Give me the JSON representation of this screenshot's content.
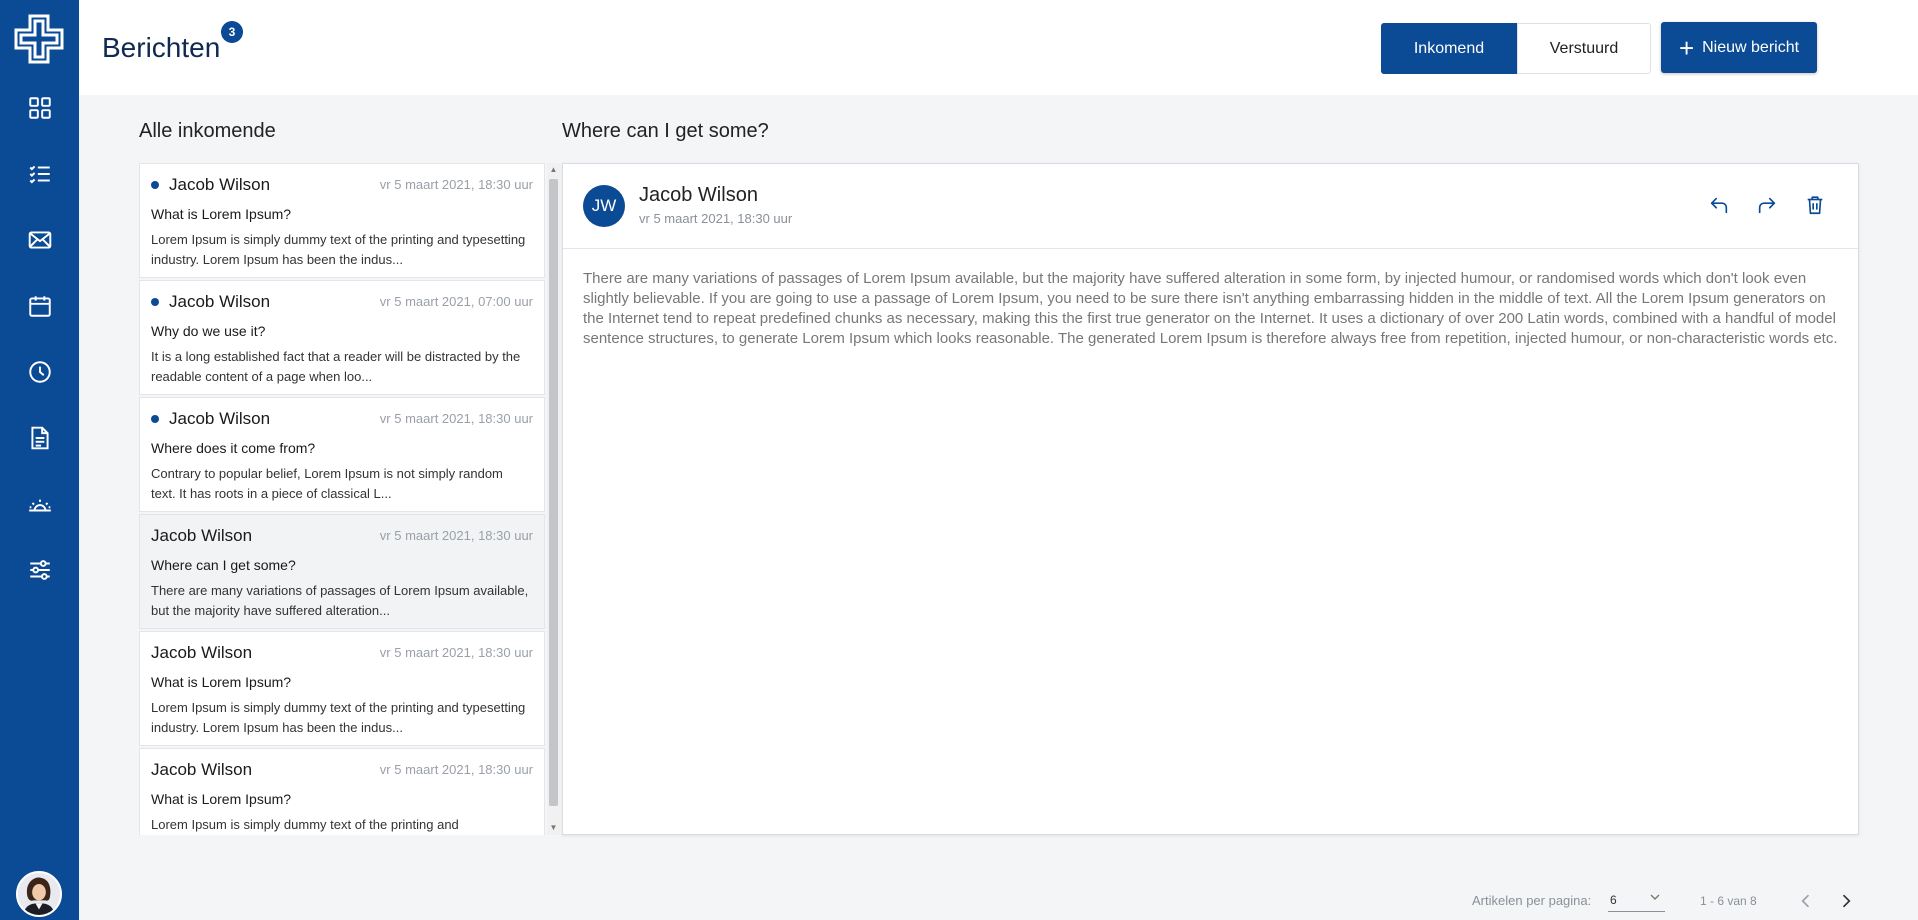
{
  "colors": {
    "primary": "#0b4a94",
    "background": "#f4f5f7",
    "unread_dot": "#0b4a94"
  },
  "sidebar": {
    "logo": "brand-cross-logo",
    "items": [
      {
        "icon": "dashboard-grid-icon"
      },
      {
        "icon": "checklist-icon"
      },
      {
        "icon": "mail-icon"
      },
      {
        "icon": "calendar-icon"
      },
      {
        "icon": "clock-icon"
      },
      {
        "icon": "document-icon"
      },
      {
        "icon": "sunrise-icon"
      },
      {
        "icon": "sliders-icon"
      }
    ],
    "user_avatar": "user-avatar"
  },
  "header": {
    "title": "Berichten",
    "badge": "3",
    "tab_incoming": "Inkomend",
    "tab_sent": "Verstuurd",
    "new_message": "Nieuw bericht"
  },
  "list": {
    "heading": "Alle inkomende",
    "messages": [
      {
        "sender": "Jacob Wilson",
        "date": "vr 5 maart 2021, 18:30 uur",
        "subject": "What is Lorem Ipsum?",
        "preview": "Lorem Ipsum is simply dummy text of the printing and typesetting industry. Lorem Ipsum has been the indus...",
        "unread": true,
        "selected": false
      },
      {
        "sender": "Jacob Wilson",
        "date": "vr 5 maart 2021, 07:00 uur",
        "subject": "Why do we use it?",
        "preview": "It is a long established fact that a reader will be distracted by the readable content of a page when loo...",
        "unread": true,
        "selected": false
      },
      {
        "sender": "Jacob Wilson",
        "date": "vr 5 maart 2021, 18:30 uur",
        "subject": "Where does it come from?",
        "preview": "Contrary to popular belief, Lorem Ipsum is not simply random text. It has roots in a piece of classical L...",
        "unread": true,
        "selected": false
      },
      {
        "sender": "Jacob Wilson",
        "date": "vr 5 maart 2021, 18:30 uur",
        "subject": "Where can I get some?",
        "preview": "There are many variations of passages of Lorem Ipsum available, but the majority have suffered alteration...",
        "unread": false,
        "selected": true
      },
      {
        "sender": "Jacob Wilson",
        "date": "vr 5 maart 2021, 18:30 uur",
        "subject": "What is Lorem Ipsum?",
        "preview": "Lorem Ipsum is simply dummy text of the printing and typesetting industry. Lorem Ipsum has been the indus...",
        "unread": false,
        "selected": false
      },
      {
        "sender": "Jacob Wilson",
        "date": "vr 5 maart 2021, 18:30 uur",
        "subject": "What is Lorem Ipsum?",
        "preview": "Lorem Ipsum is simply dummy text of the printing and",
        "unread": false,
        "selected": false
      }
    ]
  },
  "detail": {
    "heading": "Where can I get some?",
    "avatar_initials": "JW",
    "sender": "Jacob Wilson",
    "date": "vr 5 maart 2021, 18:30 uur",
    "actions": [
      "reply-icon",
      "forward-icon",
      "trash-icon"
    ],
    "body": "There are many variations of passages of Lorem Ipsum available, but the majority have suffered alteration in some form, by injected humour, or randomised words which don't look even slightly believable. If you are going to use a passage of Lorem Ipsum, you need to be sure there isn't anything embarrassing hidden in the middle of text. All the Lorem Ipsum generators on the Internet tend to repeat predefined chunks as necessary, making this the first true generator on the Internet. It uses a dictionary of over 200 Latin words, combined with a handful of model sentence structures, to generate Lorem Ipsum which looks reasonable. The generated Lorem Ipsum is therefore always free from repetition, injected humour, or non-characteristic words etc."
  },
  "pagination": {
    "per_page_label": "Artikelen per pagina:",
    "per_page_value": "6",
    "range": "1 - 6 van 8"
  }
}
